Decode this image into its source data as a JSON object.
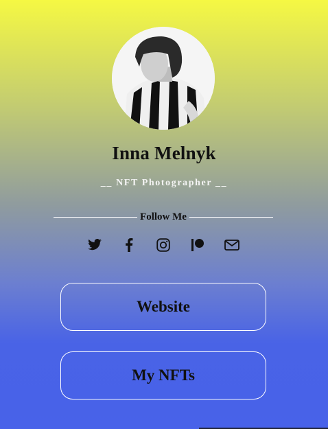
{
  "profile": {
    "name": "Inna Melnyk",
    "tagline": "__ NFT Photographer __"
  },
  "follow": {
    "label": "Follow Me"
  },
  "socials": [
    {
      "icon": "twitter-icon"
    },
    {
      "icon": "facebook-icon"
    },
    {
      "icon": "instagram-icon"
    },
    {
      "icon": "patreon-icon"
    },
    {
      "icon": "mail-icon"
    }
  ],
  "links": {
    "website_label": "Website",
    "nfts_label": "My NFTs"
  },
  "colors": {
    "gradient_top": "#f5f843",
    "gradient_bottom": "#4862e9",
    "text": "#111111",
    "border": "#ffffff"
  }
}
